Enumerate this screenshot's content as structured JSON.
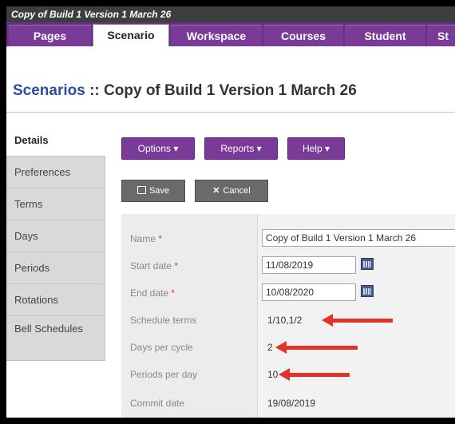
{
  "window": {
    "title": "Copy of Build 1 Version 1 March 26"
  },
  "nav": {
    "tabs": [
      {
        "label": "Pages"
      },
      {
        "label": "Scenario",
        "active": true
      },
      {
        "label": "Workspace"
      },
      {
        "label": "Courses"
      },
      {
        "label": "Student"
      },
      {
        "label": "St"
      }
    ]
  },
  "page": {
    "breadcrumb": "Scenarios",
    "separator": " :: ",
    "title": "Copy of Build 1 Version 1 March 26"
  },
  "side_tabs": [
    {
      "label": "Details",
      "active": true
    },
    {
      "label": "Preferences"
    },
    {
      "label": "Terms"
    },
    {
      "label": "Days"
    },
    {
      "label": "Periods"
    },
    {
      "label": "Rotations"
    },
    {
      "label": "Bell Schedules"
    }
  ],
  "toolbar": {
    "options": "Options ▾",
    "reports": "Reports ▾",
    "help": "Help ▾",
    "save": "Save",
    "cancel": "Cancel"
  },
  "form": {
    "name": {
      "label": "Name",
      "required": "*",
      "value": "Copy of Build 1 Version 1 March 26"
    },
    "start_date": {
      "label": "Start date",
      "required": "*",
      "value": "11/08/2019"
    },
    "end_date": {
      "label": "End date",
      "required": "*",
      "value": "10/08/2020"
    },
    "schedule_terms": {
      "label": "Schedule terms",
      "value": "1/10,1/2"
    },
    "days_per_cycle": {
      "label": "Days per cycle",
      "value": "2"
    },
    "periods_per_day": {
      "label": "Periods per day",
      "value": "10"
    },
    "commit_date": {
      "label": "Commit date",
      "value": "19/08/2019"
    }
  },
  "colors": {
    "brand_purple": "#6b2d88",
    "title_link": "#2a4ea0",
    "annotation_arrow": "#e2322a"
  }
}
